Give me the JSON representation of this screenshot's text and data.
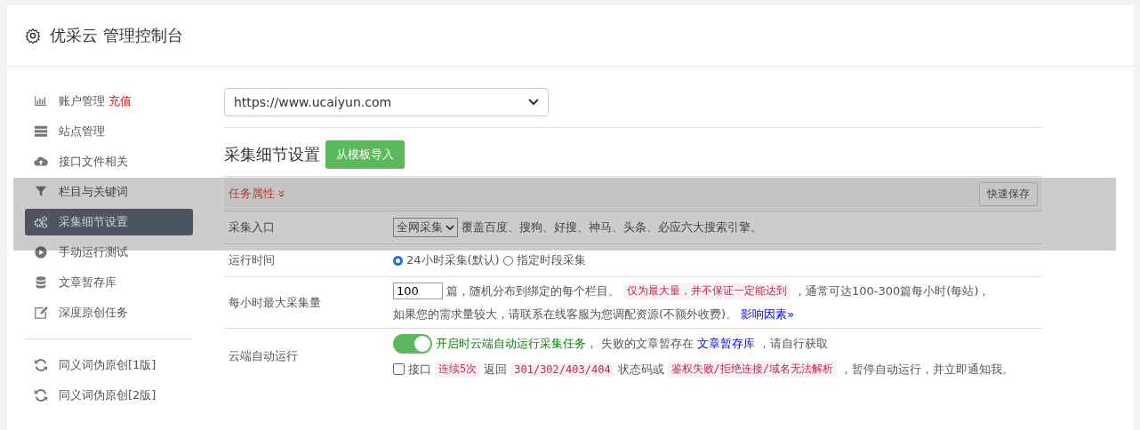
{
  "header": {
    "title": "优采云 管理控制台"
  },
  "sidebar": {
    "items": [
      {
        "label": "账户管理",
        "badge": "充值",
        "selected": false
      },
      {
        "label": "站点管理",
        "selected": false
      },
      {
        "label": "接口文件相关",
        "selected": false
      },
      {
        "label": "栏目与关键词",
        "selected": false
      },
      {
        "label": "采集细节设置",
        "selected": true
      },
      {
        "label": "手动运行测试",
        "selected": false
      },
      {
        "label": "文章暂存库",
        "selected": false
      },
      {
        "label": "深度原创任务",
        "selected": false
      }
    ],
    "items_2": [
      {
        "label": "同义词伪原创[1版]",
        "selected": false
      },
      {
        "label": "同义词伪原创[2版]",
        "selected": false
      }
    ]
  },
  "site_select": {
    "value": "https://www.ucaiyun.com"
  },
  "section": {
    "title": "采集细节设置",
    "import_button": "从模板导入"
  },
  "panel": {
    "tab": "任务属性",
    "save_button": "快速保存",
    "rows": [
      {
        "label": "采集入口",
        "parts": [
          {
            "kind": "select",
            "value": "全网采集"
          },
          {
            "kind": "text",
            "text": "覆盖百度、搜狗、好搜、神马、头条、必应六大搜索引擎。"
          }
        ]
      },
      {
        "label": "运行时间",
        "parts": [
          {
            "kind": "radio",
            "text": "24小时采集(默认)",
            "selected": true
          },
          {
            "kind": "radio",
            "text": "指定时段采集",
            "selected": false
          }
        ]
      },
      {
        "label": "每小时最大采集量",
        "parts": [
          {
            "kind": "input",
            "value": "100"
          },
          {
            "kind": "text",
            "text": "篇，随机分布到绑定的每个栏目。"
          },
          {
            "kind": "code",
            "text": "仅为最大量，并不保证一定能达到"
          },
          {
            "kind": "text",
            "text": "，通常可达100-300篇每小时(每站)，"
          },
          {
            "kind": "break"
          },
          {
            "kind": "text",
            "text": "如果您的需求量较大，请联系在线客服为您调配资源(不额外收费)。"
          },
          {
            "kind": "link",
            "text": "影响因素»"
          }
        ]
      },
      {
        "label": "云端自动运行",
        "parts": [
          {
            "kind": "toggle",
            "on": true
          },
          {
            "kind": "note",
            "text": "开启时云端自动运行采集任务，"
          },
          {
            "kind": "text",
            "text": "失败的文章暂存在"
          },
          {
            "kind": "link",
            "text": "文章暂存库"
          },
          {
            "kind": "text",
            "text": "，请自行获取"
          },
          {
            "kind": "break"
          },
          {
            "kind": "checkbox",
            "text": "接口",
            "checked": false
          },
          {
            "kind": "code",
            "text": "连续5次"
          },
          {
            "kind": "text",
            "text": "返回"
          },
          {
            "kind": "code",
            "text": "301/302/403/404"
          },
          {
            "kind": "text",
            "text": "状态码或"
          },
          {
            "kind": "code",
            "text": "鉴权失败/拒绝连接/域名无法解析"
          },
          {
            "kind": "text",
            "text": "，暂停自动运行，并立即通知我。"
          }
        ]
      }
    ]
  }
}
